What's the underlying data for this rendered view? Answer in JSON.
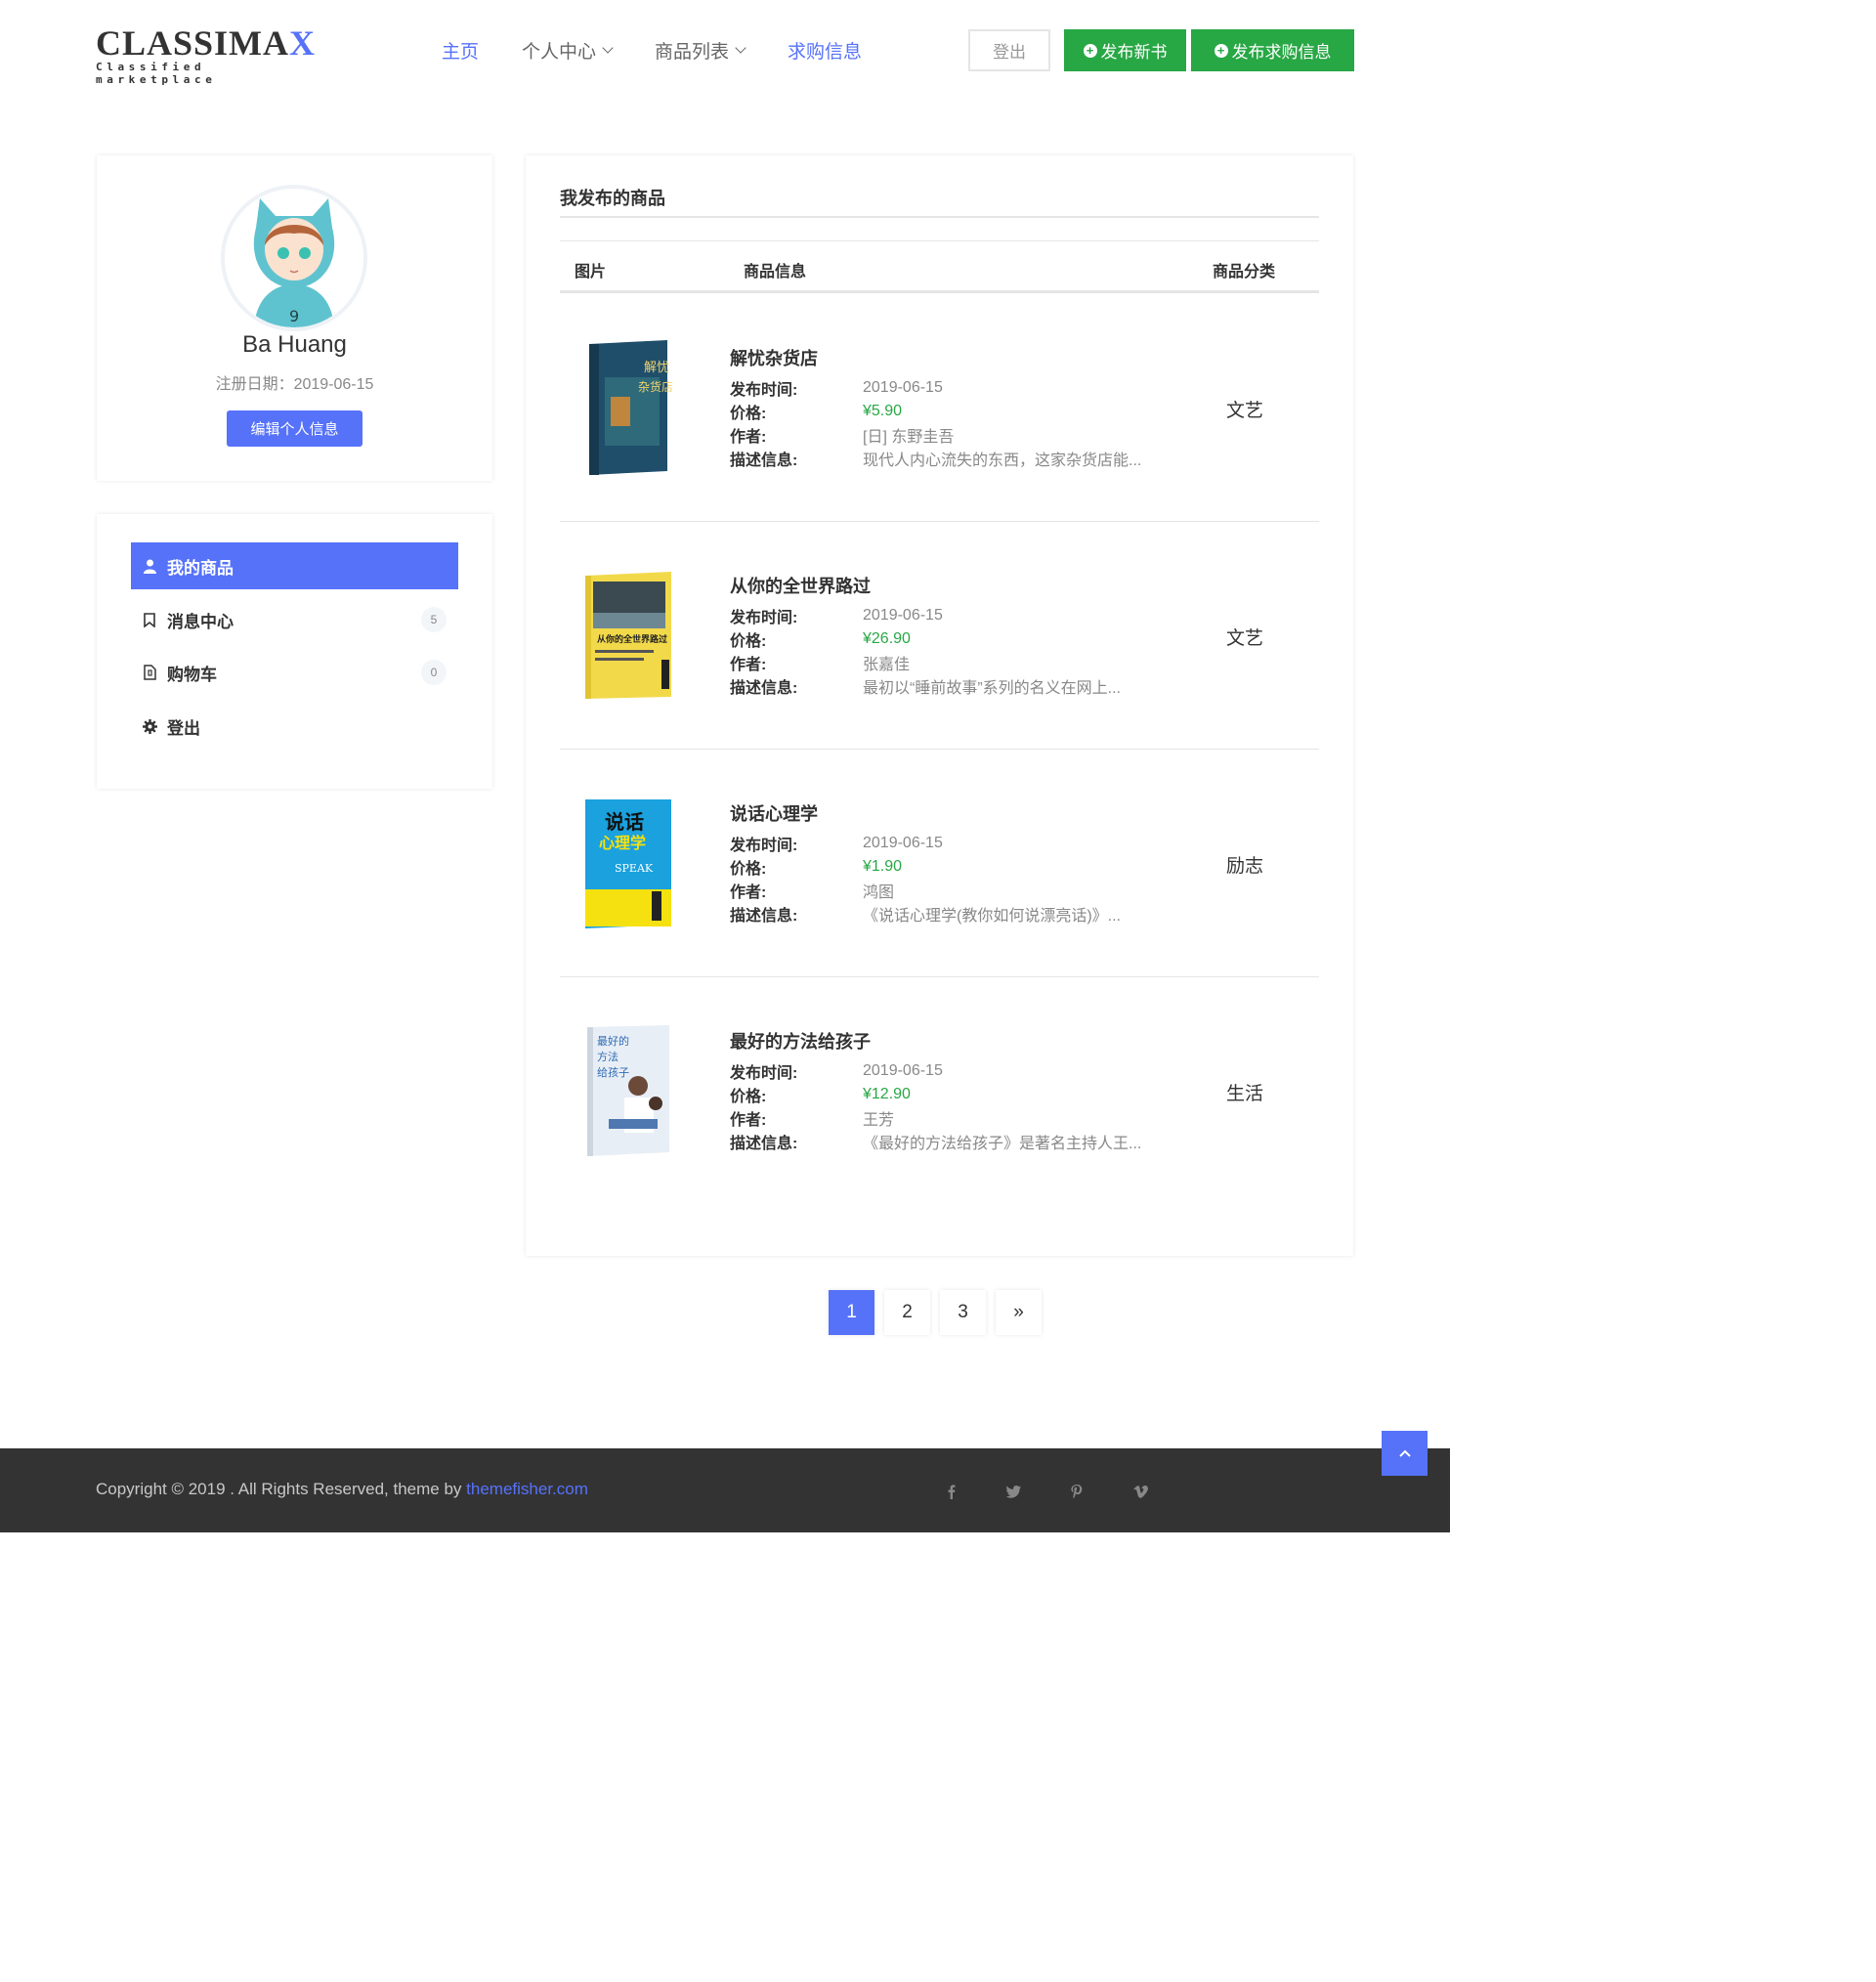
{
  "header": {
    "logo_main_left": "CLASSIMA",
    "logo_main_accent": "X",
    "logo_sub": "Classified marketplace",
    "nav": [
      {
        "label": "主页"
      },
      {
        "label": "个人中心"
      },
      {
        "label": "商品列表"
      },
      {
        "label": "求购信息"
      }
    ],
    "logout_label": "登出",
    "new_book_label": "发布新书",
    "new_want_label": "发布求购信息"
  },
  "profile": {
    "name": "Ba Huang",
    "register_date": "注册日期：2019-06-15",
    "edit_label": "编辑个人信息"
  },
  "menu": {
    "items": [
      {
        "label": "我的商品",
        "icon": "user-icon"
      },
      {
        "label": "消息中心",
        "icon": "bookmark-icon",
        "badge": "5"
      },
      {
        "label": "购物车",
        "icon": "file-archive-icon",
        "badge": "0"
      },
      {
        "label": "登出",
        "icon": "gear-icon"
      }
    ]
  },
  "products": {
    "title": "我发布的商品",
    "headers": {
      "image": "图片",
      "info": "商品信息",
      "category": "商品分类"
    },
    "labels": {
      "time": "发布时间:",
      "price": "价格:",
      "author": "作者:",
      "desc": "描述信息:"
    },
    "items": [
      {
        "title": "解忧杂货店",
        "time": "2019-06-15",
        "price": "¥5.90",
        "author": "[日] 东野圭吾",
        "desc": "现代人内心流失的东西，这家杂货店能...",
        "category": "文艺",
        "cover_color": "#1f4e6b"
      },
      {
        "title": "从你的全世界路过",
        "time": "2019-06-15",
        "price": "¥26.90",
        "author": "张嘉佳",
        "desc": "最初以“睡前故事”系列的名义在网上...",
        "category": "文艺",
        "cover_color": "#f2d94a"
      },
      {
        "title": "说话心理学",
        "time": "2019-06-15",
        "price": "¥1.90",
        "author": "鸿图",
        "desc": "《说话心理学(教你如何说漂亮话)》...",
        "category": "励志",
        "cover_color": "#1aa1de"
      },
      {
        "title": "最好的方法给孩子",
        "time": "2019-06-15",
        "price": "¥12.90",
        "author": "王芳",
        "desc": "《最好的方法给孩子》是著名主持人王...",
        "category": "生活",
        "cover_color": "#e8eef5"
      }
    ]
  },
  "pagination": {
    "pages": [
      "1",
      "2",
      "3",
      "»"
    ],
    "current": "1"
  },
  "footer": {
    "copyright_text": "Copyright © 2019 . All Rights Reserved, theme by ",
    "link_text": "themefisher.com",
    "social": [
      "facebook-icon",
      "twitter-icon",
      "pinterest-icon",
      "vimeo-icon"
    ]
  },
  "colors": {
    "accent": "#5672f9",
    "green": "#28a745",
    "footer_bg": "#333334"
  }
}
